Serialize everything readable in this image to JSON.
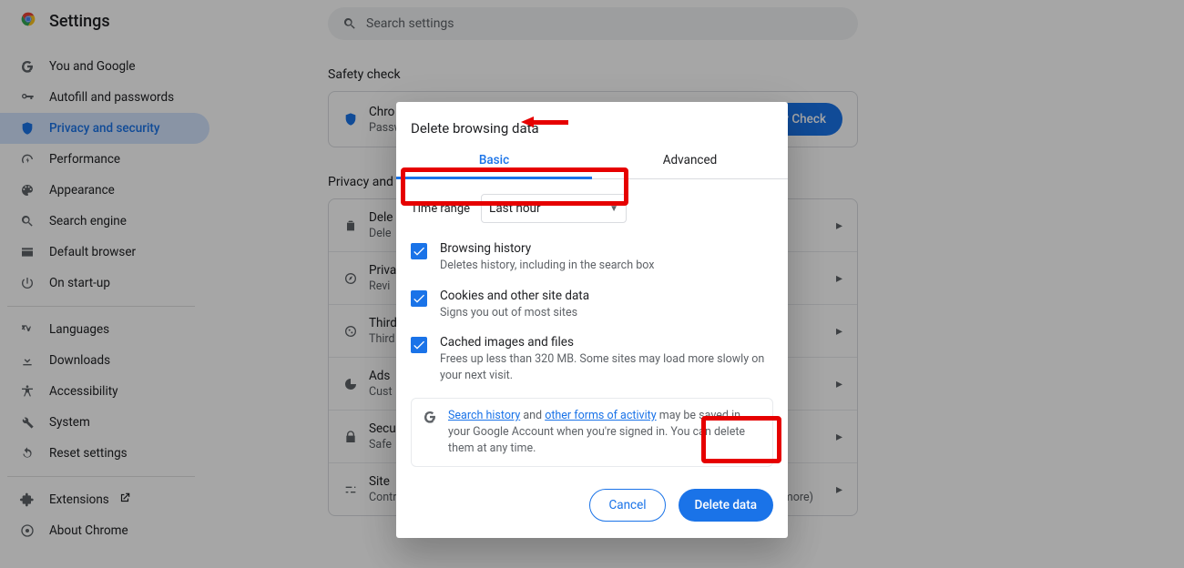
{
  "header": {
    "title": "Settings"
  },
  "search": {
    "placeholder": "Search settings"
  },
  "sidebar": {
    "items": [
      {
        "label": "You and Google"
      },
      {
        "label": "Autofill and passwords"
      },
      {
        "label": "Privacy and security"
      },
      {
        "label": "Performance"
      },
      {
        "label": "Appearance"
      },
      {
        "label": "Search engine"
      },
      {
        "label": "Default browser"
      },
      {
        "label": "On start-up"
      }
    ],
    "secondary": [
      {
        "label": "Languages"
      },
      {
        "label": "Downloads"
      },
      {
        "label": "Accessibility"
      },
      {
        "label": "System"
      },
      {
        "label": "Reset settings"
      }
    ],
    "footer": [
      {
        "label": "Extensions"
      },
      {
        "label": "About Chrome"
      }
    ]
  },
  "sections": {
    "safety": {
      "heading": "Safety check",
      "row_title_prefix": "Chro",
      "row_sub_prefix": "Passw",
      "button": "ty Check"
    },
    "privacy": {
      "heading": "Privacy and s",
      "rows": [
        {
          "title": "Dele",
          "sub": "Dele"
        },
        {
          "title": "Priva",
          "sub": "Revi"
        },
        {
          "title": "Third",
          "sub": "Third"
        },
        {
          "title": "Ads",
          "sub": "Cust"
        },
        {
          "title": "Secu",
          "sub": "Safe"
        },
        {
          "title": "Site",
          "sub": "Controls what information sites can use and show (location, camera, pop-ups and more)"
        }
      ]
    }
  },
  "dialog": {
    "title": "Delete browsing data",
    "tabs": {
      "basic": "Basic",
      "advanced": "Advanced"
    },
    "time_label": "Time range",
    "time_value": "Last hour",
    "options": [
      {
        "title": "Browsing history",
        "sub": "Deletes history, including in the search box"
      },
      {
        "title": "Cookies and other site data",
        "sub": "Signs you out of most sites"
      },
      {
        "title": "Cached images and files",
        "sub": "Frees up less than 320 MB. Some sites may load more slowly on your next visit."
      }
    ],
    "info": {
      "link1": "Search history",
      "mid": " and ",
      "link2": "other forms of activity",
      "tail": " may be saved in your Google Account when you're signed in. You can delete them at any time."
    },
    "cancel": "Cancel",
    "confirm": "Delete data"
  }
}
